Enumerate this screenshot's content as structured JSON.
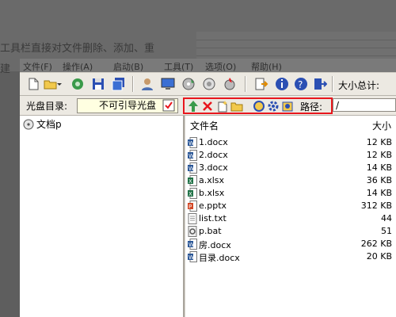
{
  "background": {
    "text_line_1": "工具栏直接对文件删除、添加、重",
    "text_line_2": "建"
  },
  "menu": [
    "文件(F)",
    "操作(A)",
    "启动(B)",
    "工具(T)",
    "选项(O)",
    "帮助(H)"
  ],
  "toolbar": {
    "size_total_label": "大小总计:"
  },
  "disc": {
    "label": "光盘目录:",
    "value": "不可引导光盘"
  },
  "path": {
    "label": "路径:",
    "value": "/"
  },
  "tree": {
    "root": "文档p"
  },
  "filelist": {
    "col_name": "文件名",
    "col_size": "大小",
    "files": [
      {
        "name": "1.docx",
        "size": "12 KB",
        "type": "word"
      },
      {
        "name": "2.docx",
        "size": "12 KB",
        "type": "word"
      },
      {
        "name": "3.docx",
        "size": "14 KB",
        "type": "word"
      },
      {
        "name": "a.xlsx",
        "size": "36 KB",
        "type": "excel"
      },
      {
        "name": "b.xlsx",
        "size": "14 KB",
        "type": "excel"
      },
      {
        "name": "e.pptx",
        "size": "312 KB",
        "type": "ppt"
      },
      {
        "name": "list.txt",
        "size": "44",
        "type": "text"
      },
      {
        "name": "p.bat",
        "size": "51",
        "type": "bat"
      },
      {
        "name": "房.docx",
        "size": "262 KB",
        "type": "word"
      },
      {
        "name": "目录.docx",
        "size": "20 KB",
        "type": "word"
      }
    ]
  },
  "colors": {
    "highlight": "#e8161d",
    "word": "#2b5797",
    "excel": "#1e7145",
    "ppt": "#d24726"
  }
}
